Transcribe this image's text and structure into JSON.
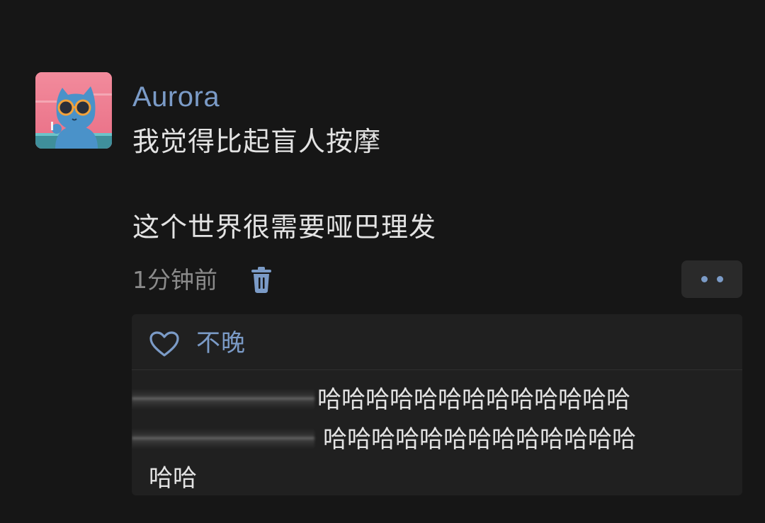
{
  "post": {
    "author": "Aurora",
    "lines": [
      "我觉得比起盲人按摩",
      "这个世界很需要哑巴理发"
    ],
    "time": "1分钟前",
    "icons": {
      "delete": "trash-icon",
      "more": "more-dots-icon"
    }
  },
  "likes": {
    "icon": "heart-outline-icon",
    "names": "不晚"
  },
  "reply": {
    "lines": [
      "哈哈哈哈哈哈哈哈哈哈哈哈哈",
      "哈哈哈哈哈哈哈哈哈哈哈哈哈",
      "哈哈"
    ]
  },
  "colors": {
    "background": "#161616",
    "accent": "#7b9bc7",
    "text": "#e3e3e3",
    "muted": "#8b8b8b",
    "panel": "#202020"
  }
}
